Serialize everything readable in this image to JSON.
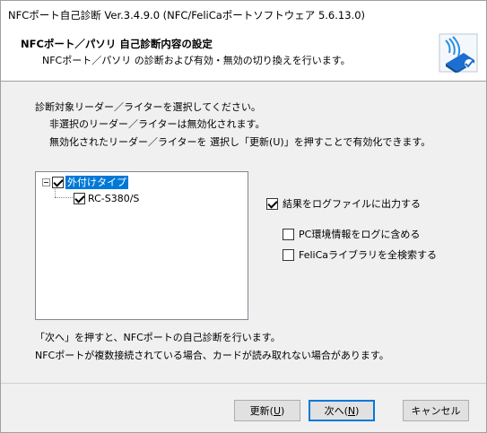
{
  "window": {
    "title": "NFCポート自己診断 Ver.3.4.9.0 (NFC/FeliCaポートソフトウェア 5.6.13.0)"
  },
  "header": {
    "title": "NFCポート／パソリ 自己診断内容の設定",
    "subtitle": "NFCポート／パソリ の診断および有効・無効の切り換えを行います。",
    "logo_icon": "nfc-reader-icon"
  },
  "instructions": {
    "line1": "診断対象リーダー／ライターを選択してください。",
    "line2": "非選択のリーダー／ライターは無効化されます。",
    "line3": "無効化されたリーダー／ライターを 選択し「更新(U)」を押すことで有効化できます。"
  },
  "tree": {
    "root": {
      "label": "外付けタイプ",
      "checked": true,
      "expanded": true
    },
    "child": {
      "label": "RC-S380/S",
      "checked": true
    }
  },
  "options": {
    "log_output": {
      "label": "結果をログファイルに出力する",
      "checked": true
    },
    "pc_env": {
      "label": "PC環境情報をログに含める",
      "checked": false
    },
    "felica_search": {
      "label": "FeliCaライブラリを全検索する",
      "checked": false
    }
  },
  "notes": {
    "line1": "「次へ」を押すと、NFCポートの自己診断を行います。",
    "line2": "NFCポートが複数接続されている場合、カードが読み取れない場合があります。"
  },
  "buttons": {
    "update": {
      "label": "更新(",
      "key": "U",
      "end": ")"
    },
    "next": {
      "label": "次へ(",
      "key": "N",
      "end": ")"
    },
    "cancel": {
      "label": "キャンセル"
    }
  }
}
